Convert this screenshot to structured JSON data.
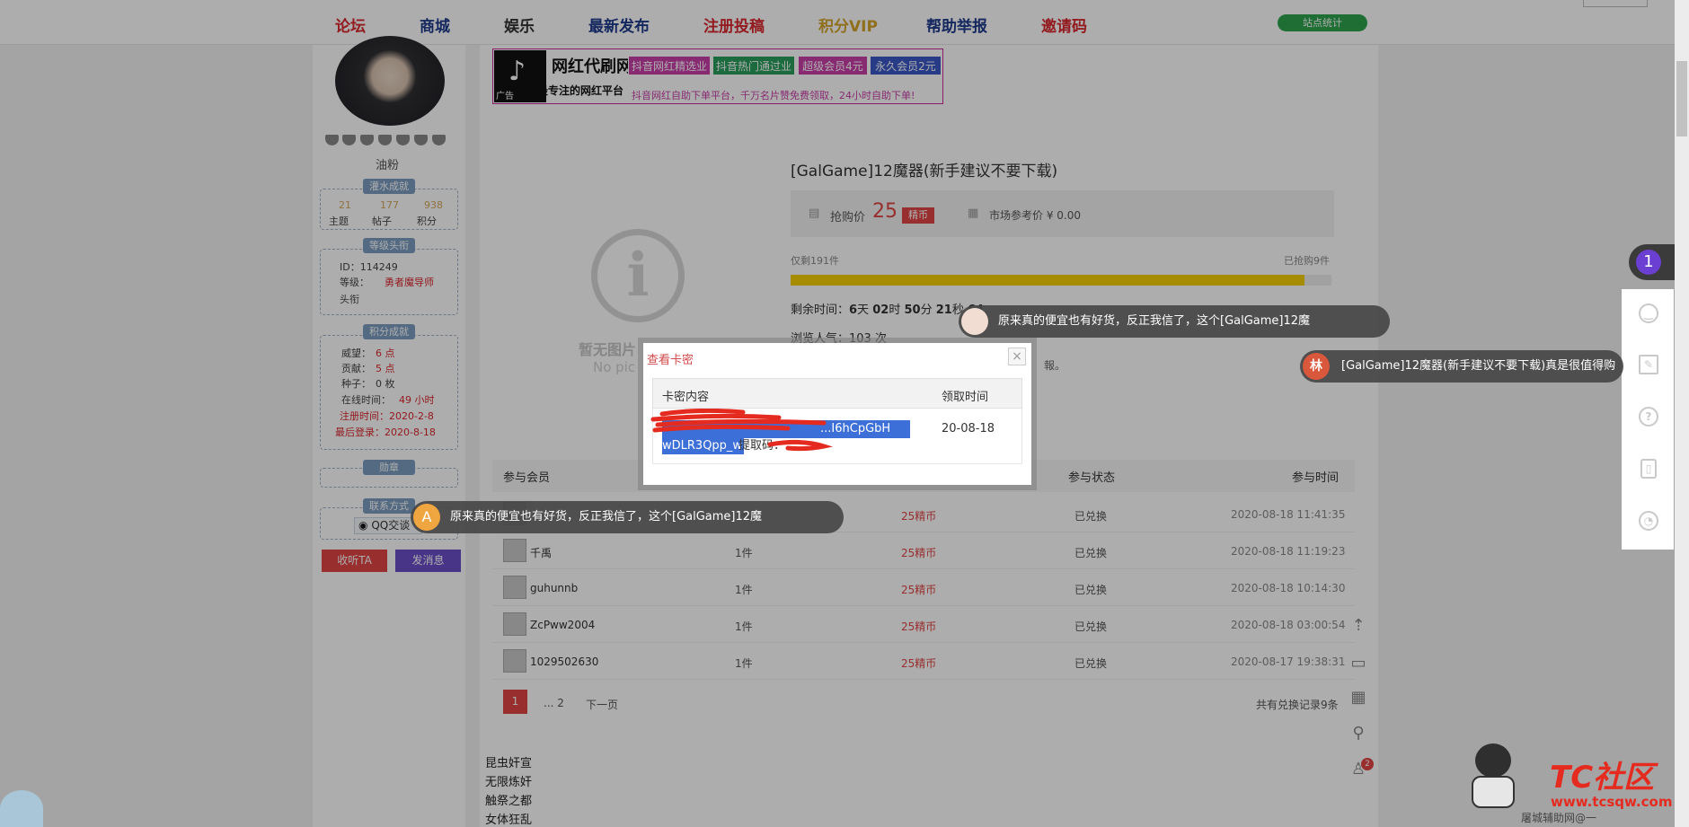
{
  "nav": {
    "items": [
      {
        "label": "论坛",
        "color": "#d9272e"
      },
      {
        "label": "商城",
        "color": "#1e3a8c"
      },
      {
        "label": "娱乐",
        "color": "#333333"
      },
      {
        "label": "最新发布",
        "color": "#1e3a8c"
      },
      {
        "label": "注册投稿",
        "color": "#d9272e"
      },
      {
        "label": "积分VIP",
        "color": "#d4a52b"
      },
      {
        "label": "帮助举报",
        "color": "#1e3a8c"
      },
      {
        "label": "邀请码",
        "color": "#d9272e"
      }
    ],
    "stats_button": "站点统计"
  },
  "profile": {
    "group": "油粉",
    "water_title": "灌水成就",
    "water_stats": [
      {
        "num": "21",
        "label": "主题"
      },
      {
        "num": "177",
        "label": "帖子"
      },
      {
        "num": "938",
        "label": "积分"
      }
    ],
    "basic_title": "等级头衔",
    "id_label": "ID：114249",
    "level_label": "等级：",
    "level_value": "勇者魔导师",
    "title_label": "头衔",
    "score_title": "积分成就",
    "score_items": [
      {
        "label": "威望：",
        "value": "6 点"
      },
      {
        "label": "贡献：",
        "value": "5 点"
      },
      {
        "label": "种子：",
        "value": "0 枚"
      },
      {
        "label": "在线时间：",
        "value": "49 小时"
      }
    ],
    "register_time": "注册时间：2020-2-8",
    "last_login": "最后登录：2020-8-18",
    "medal_title": "勋章",
    "contact_title": "联系方式",
    "qq_label": "QQ交谈",
    "follow_button": "收听TA",
    "message_button": "发消息"
  },
  "ad": {
    "brand": "网红代刷网",
    "slogan": "最专注的网红平台",
    "tag": "广告",
    "chips": [
      {
        "label": "抖音网红精选业务",
        "color": "#c93fa8"
      },
      {
        "label": "抖音热门通过业务",
        "color": "#2a9e5e"
      },
      {
        "label": "超级会员4元",
        "color": "#c93fa8"
      },
      {
        "label": "永久会员2元",
        "color": "#3a58c7"
      }
    ],
    "bottom_text": "抖音网红自助下单平台，千万名片赞免费领取，24小时自助下单!"
  },
  "product": {
    "title": "[GalGame]12魔器(新手建议不要下载)",
    "price_label": "抢购价",
    "price_value": "25",
    "price_unit": "精币",
    "market_label": "市场参考价 ¥ 0.00",
    "remaining_label": "仅剩191件",
    "sold_label": "已抢购9件",
    "sold_fraction": 0.95,
    "time_label": "剩余时间：",
    "days": "6",
    "hours": "02",
    "minutes": "50",
    "seconds": "21",
    "ms": "64",
    "day_unit": "天",
    "hour_unit": "时",
    "minute_unit": "分",
    "second_unit": "秒",
    "popularity": "浏览人气：103 次",
    "side_note": "報。",
    "empty_label": "暂无图片",
    "empty_sub": "No pic"
  },
  "participants": {
    "headers": [
      "参与会员",
      "参与状态",
      "参与时间"
    ],
    "rows": [
      {
        "name": "",
        "qty": "1件",
        "cost": "25精币",
        "status": "已兑换",
        "time": "2020-08-18 11:41:35"
      },
      {
        "name": "千禹",
        "qty": "1件",
        "cost": "25精币",
        "status": "已兑换",
        "time": "2020-08-18 11:19:23"
      },
      {
        "name": "guhunnb",
        "qty": "1件",
        "cost": "25精币",
        "status": "已兑换",
        "time": "2020-08-18 10:14:30"
      },
      {
        "name": "ZcPww2004",
        "qty": "1件",
        "cost": "25精币",
        "status": "已兑换",
        "time": "2020-08-18 03:00:54"
      },
      {
        "name": "1029502630",
        "qty": "1件",
        "cost": "25精币",
        "status": "已兑换",
        "time": "2020-08-17 19:38:31"
      }
    ],
    "page_current": "1",
    "page_more": "... 2",
    "next_label": "下一页",
    "total_label": "共有兑换记录9条"
  },
  "footer_links": [
    "昆虫奸宣",
    "无限炼奸",
    "触祭之都",
    "女体狂乱"
  ],
  "dialog": {
    "title": "查看卡密",
    "close": "×",
    "col_content": "卡密内容",
    "col_time": "领取时间",
    "code_line1": "...I6hCpGbH",
    "code_line2": "wDLR3Qpp_w",
    "code_suffix": " 提取码：",
    "time": "20-08-18"
  },
  "danmu": [
    {
      "text": "原来真的便宜也有好货，反正我信了，这个[GalGame]12魔",
      "avatar": "A"
    },
    {
      "text": "原来真的便宜也有好货，反正我信了，这个[GalGame]12魔",
      "avatar": ""
    },
    {
      "text": "[GalGame]12魔器(新手建议不要下载)真是很值得购",
      "avatar": "林"
    }
  ],
  "right_badge": "1",
  "notify_count": "2",
  "watermark": {
    "brand": "TC社区",
    "url": "www.tcsqw.com",
    "sub": "屠城辅助网@一"
  }
}
